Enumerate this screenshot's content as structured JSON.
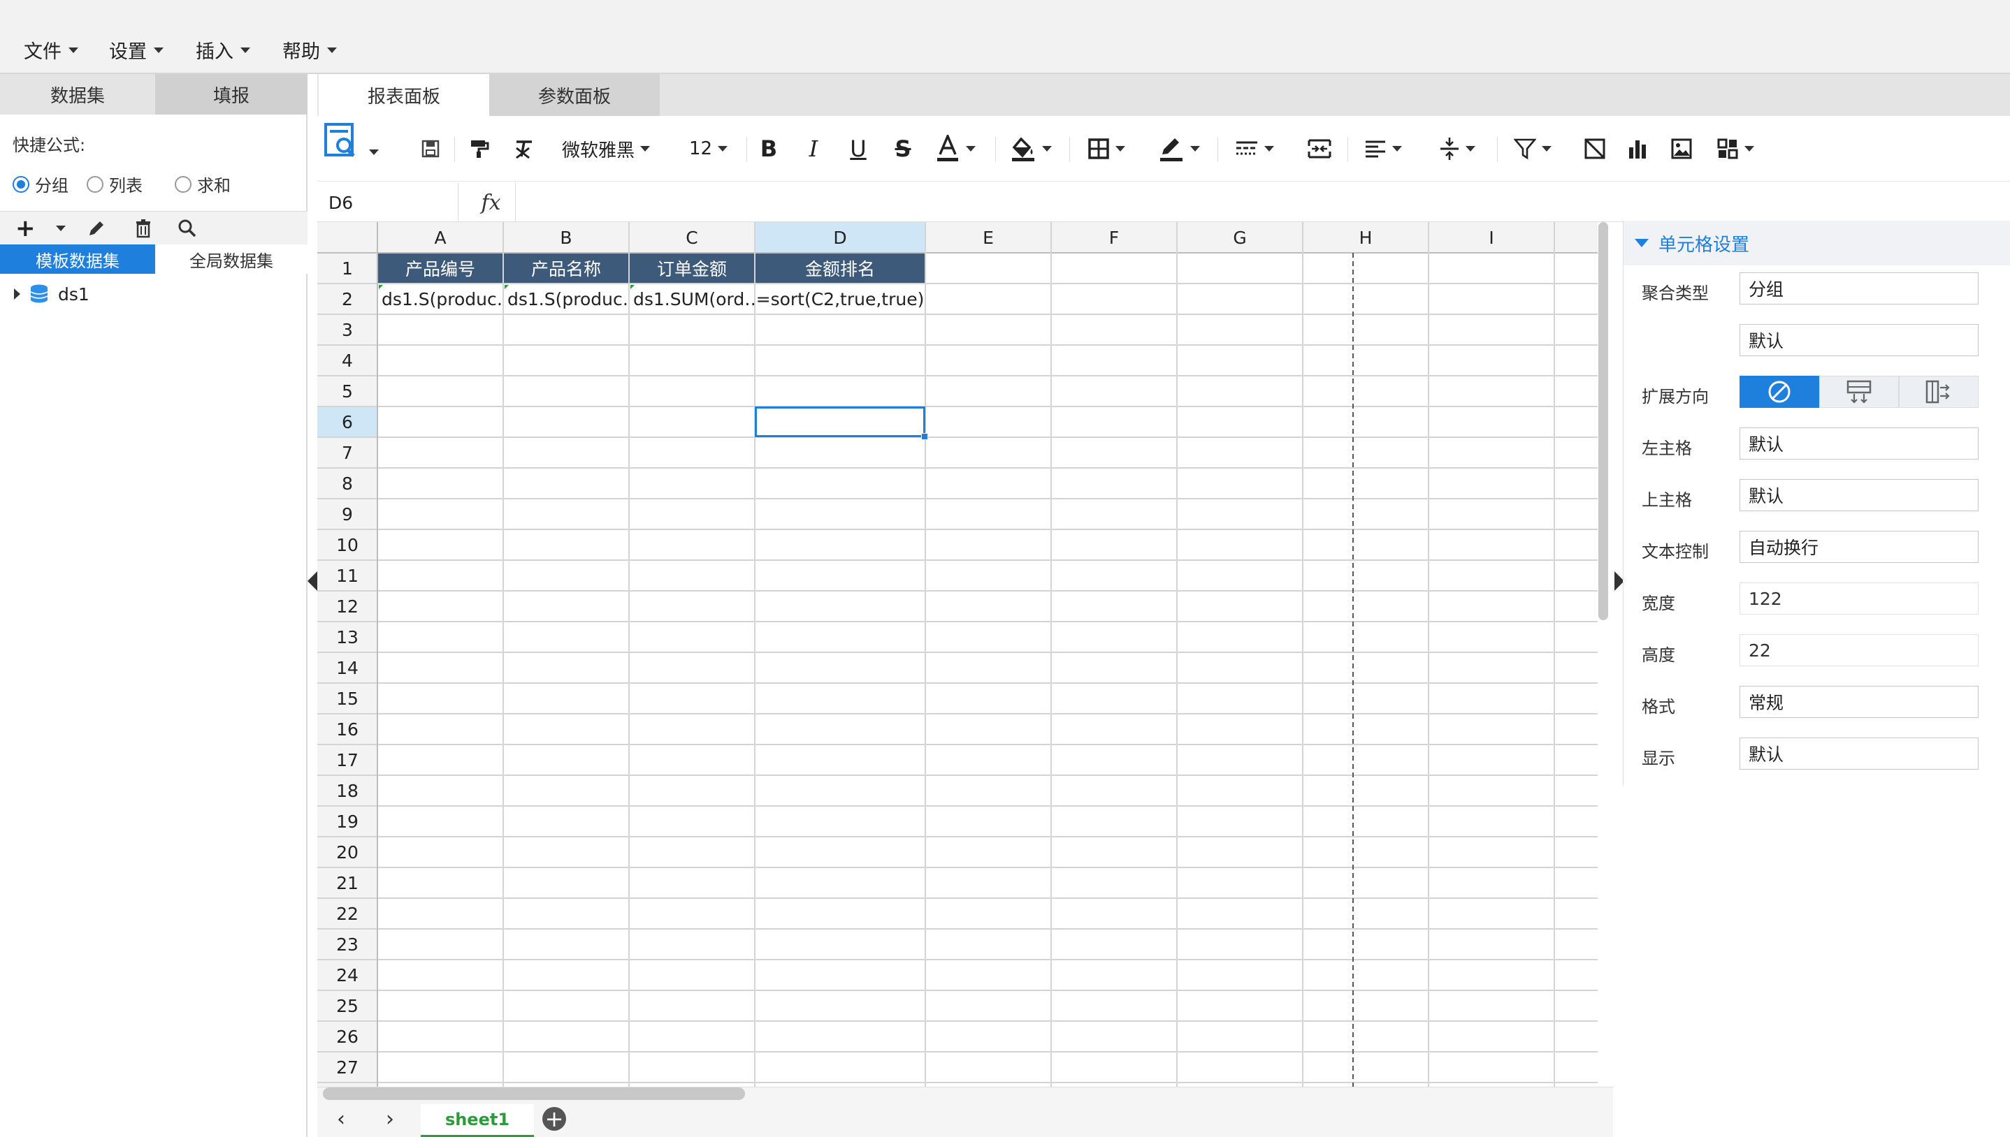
{
  "menubar": {
    "items": [
      "文件",
      "设置",
      "插入",
      "帮助"
    ]
  },
  "left_panel": {
    "tabs": [
      "数据集",
      "填报"
    ],
    "quick_formula_label": "快捷公式:",
    "radios": [
      {
        "label": "分组",
        "checked": true
      },
      {
        "label": "列表",
        "checked": false
      },
      {
        "label": "求和",
        "checked": false
      }
    ],
    "ds_tabs": [
      "模板数据集",
      "全局数据集"
    ],
    "tree": [
      {
        "label": "ds1"
      }
    ]
  },
  "main_tabs": [
    "报表面板",
    "参数面板"
  ],
  "toolbar": {
    "font_name": "微软雅黑",
    "font_size": "12"
  },
  "formula_bar": {
    "cell_ref": "D6",
    "fx": "fx"
  },
  "sheet": {
    "columns": [
      "A",
      "B",
      "C",
      "D",
      "E",
      "F",
      "G",
      "H",
      "I"
    ],
    "rows": [
      "1",
      "2",
      "3",
      "4",
      "5",
      "6",
      "7",
      "8",
      "9",
      "10",
      "11",
      "12",
      "13",
      "14",
      "15",
      "16",
      "17",
      "18",
      "19",
      "20",
      "21",
      "22",
      "23",
      "24",
      "25",
      "26",
      "27"
    ],
    "header_row": [
      "产品编号",
      "产品名称",
      "订单金额",
      "金额排名"
    ],
    "data_row": [
      "ds1.S(produc…",
      "ds1.S(produc…",
      "ds1.SUM(ord…",
      "=sort(C2,true,true)"
    ],
    "selected_cell": "D6",
    "tab": "sheet1"
  },
  "settings": {
    "title": "单元格设置",
    "fields": [
      {
        "label": "聚合类型",
        "value": "分组"
      },
      {
        "label": "",
        "value": "默认"
      },
      {
        "label": "扩展方向",
        "value": ""
      },
      {
        "label": "左主格",
        "value": "默认"
      },
      {
        "label": "上主格",
        "value": "默认"
      },
      {
        "label": "文本控制",
        "value": "自动换行"
      },
      {
        "label": "宽度",
        "value": "122"
      },
      {
        "label": "高度",
        "value": "22"
      },
      {
        "label": "格式",
        "value": "常规"
      },
      {
        "label": "显示",
        "value": "默认"
      }
    ]
  },
  "colors": {
    "accent": "#1e7fdc",
    "header_fill": "#3d5a7a",
    "sheet_tab": "#2e9a3a"
  }
}
